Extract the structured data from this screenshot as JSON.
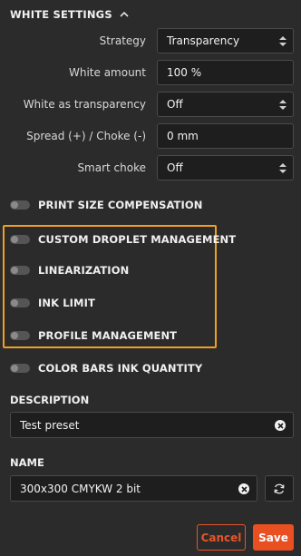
{
  "section": {
    "title": "WHITE SETTINGS"
  },
  "settings": [
    {
      "label": "Strategy",
      "value": "Transparency",
      "type": "select"
    },
    {
      "label": "White amount",
      "value": "100 %",
      "type": "input"
    },
    {
      "label": "White as transparency",
      "value": "Off",
      "type": "select"
    },
    {
      "label": "Spread (+) / Choke (-)",
      "value": "0 mm",
      "type": "input"
    },
    {
      "label": "Smart choke",
      "value": "Off",
      "type": "select"
    }
  ],
  "toggles": [
    {
      "label": "PRINT SIZE COMPENSATION",
      "on": false
    },
    {
      "label": "CUSTOM DROPLET MANAGEMENT",
      "on": false
    },
    {
      "label": "LINEARIZATION",
      "on": false
    },
    {
      "label": "INK LIMIT",
      "on": false
    },
    {
      "label": "PROFILE MANAGEMENT",
      "on": false
    },
    {
      "label": "COLOR BARS INK QUANTITY",
      "on": false
    }
  ],
  "description": {
    "caption": "DESCRIPTION",
    "value": "Test preset"
  },
  "name": {
    "caption": "NAME",
    "value": "300x300 CMYKW 2 bit"
  },
  "actions": {
    "cancel": "Cancel",
    "save": "Save"
  },
  "colors": {
    "accent": "#ea4f22",
    "highlight": "#f0a020",
    "background": "#2b2b2b"
  }
}
